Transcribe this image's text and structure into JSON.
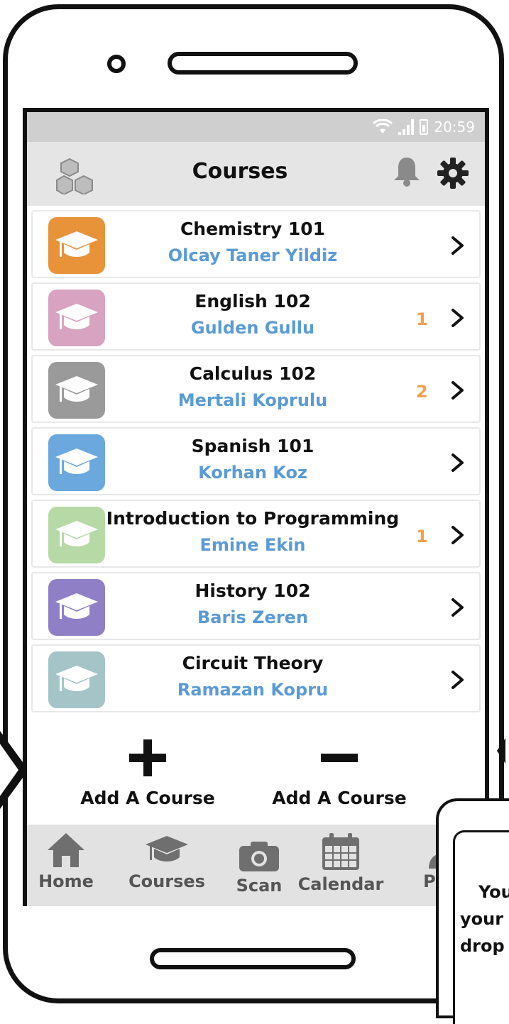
{
  "status": {
    "time": "20:59"
  },
  "header": {
    "title": "Courses"
  },
  "courses": [
    {
      "title": "Chemistry 101",
      "teacher": "Olcay Taner Yildiz",
      "badge": "",
      "color": "#e8933a"
    },
    {
      "title": "English 102",
      "teacher": "Gulden Gullu",
      "badge": "1",
      "color": "#d7a3c0"
    },
    {
      "title": "Calculus 102",
      "teacher": "Mertali Koprulu",
      "badge": "2",
      "color": "#9a9a9a"
    },
    {
      "title": "Spanish 101",
      "teacher": "Korhan Koz",
      "badge": "",
      "color": "#6aa8de"
    },
    {
      "title": "Introduction to Programming",
      "teacher": "Emine Ekin",
      "badge": "1",
      "color": "#b6d9a6"
    },
    {
      "title": "History 102",
      "teacher": "Baris Zeren",
      "badge": "",
      "color": "#8f7fc6"
    },
    {
      "title": "Circuit Theory",
      "teacher": "Ramazan Kopru",
      "badge": "",
      "color": "#a4c4c8"
    }
  ],
  "actions": {
    "add_label": "Add A Course",
    "remove_label": "Add A Course"
  },
  "tabs": [
    {
      "label": "Home",
      "icon": "home-icon"
    },
    {
      "label": "Courses",
      "icon": "graduation-cap-icon"
    },
    {
      "label": "Scan",
      "icon": "camera-icon"
    },
    {
      "label": "Calendar",
      "icon": "calendar-icon"
    },
    {
      "label": "Profi",
      "icon": "user-icon"
    }
  ],
  "tooltip": {
    "line1": "You",
    "line2": "your",
    "line3": "drop"
  },
  "colors": {
    "teacher": "#5b9bd5",
    "badge": "#f0a050",
    "header_bg": "#e5e5e5",
    "status_bg": "#cfcfcf"
  }
}
